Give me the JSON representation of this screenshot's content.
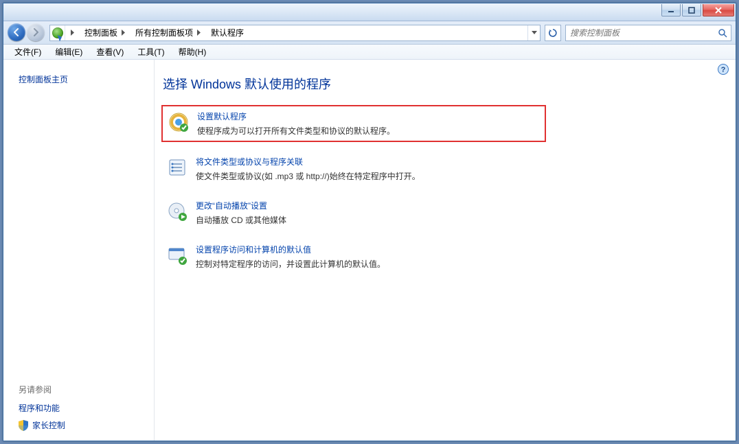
{
  "window": {
    "min_tip": "Minimize",
    "max_tip": "Maximize",
    "close_tip": "Close"
  },
  "breadcrumb": {
    "seg1": "控制面板",
    "seg2": "所有控制面板项",
    "seg3": "默认程序"
  },
  "search": {
    "placeholder": "搜索控制面板"
  },
  "menu": {
    "file": "文件(F)",
    "edit": "编辑(E)",
    "view": "查看(V)",
    "tools": "工具(T)",
    "help": "帮助(H)"
  },
  "sidebar": {
    "home": "控制面板主页",
    "seealso_header": "另请参阅",
    "links": {
      "programs": "程序和功能",
      "parental": "家长控制"
    }
  },
  "content": {
    "header": "选择 Windows 默认使用的程序",
    "opts": [
      {
        "title": "设置默认程序",
        "desc": "使程序成为可以打开所有文件类型和协议的默认程序。"
      },
      {
        "title": "将文件类型或协议与程序关联",
        "desc": "使文件类型或协议(如 .mp3 或 http://)始终在特定程序中打开。"
      },
      {
        "title": "更改“自动播放”设置",
        "desc": "自动播放 CD 或其他媒体"
      },
      {
        "title": "设置程序访问和计算机的默认值",
        "desc": "控制对特定程序的访问，并设置此计算机的默认值。"
      }
    ]
  }
}
